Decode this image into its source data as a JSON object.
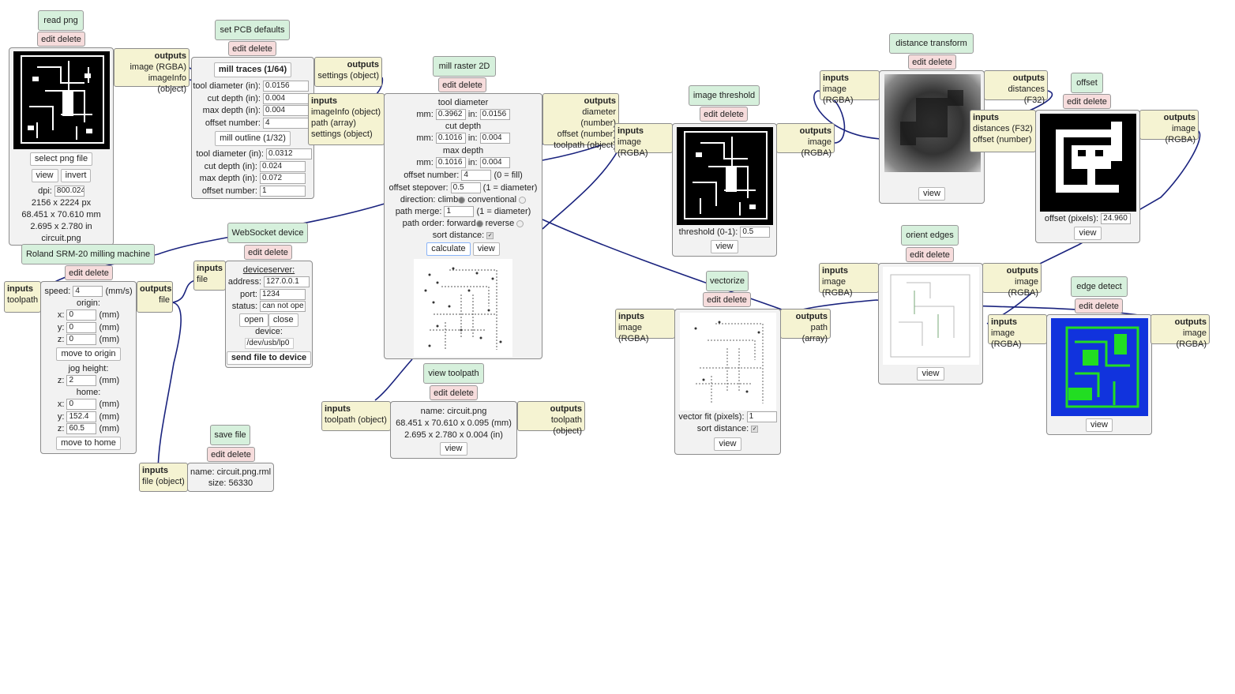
{
  "modules": {
    "read_png": {
      "title": "read png",
      "edit": "edit delete",
      "outputs_header": "outputs",
      "outputs": [
        "image (RGBA)",
        "imageInfo (object)"
      ],
      "select_btn": "select png file",
      "view_btn": "view",
      "invert_btn": "invert",
      "dpi_label": "dpi:",
      "dpi_value": "800.024",
      "px": "2156 x 2224 px",
      "mm": "68.451 x 70.610 mm",
      "in": "2.695 x 2.780 in",
      "file": "circuit.png"
    },
    "pcb_defaults": {
      "title": "set PCB defaults",
      "edit": "edit delete",
      "outputs_header": "outputs",
      "outputs": [
        "settings (object)"
      ],
      "traces_btn": "mill traces (1/64)",
      "traces": [
        {
          "label": "tool diameter (in):",
          "value": "0.0156"
        },
        {
          "label": "cut depth (in):",
          "value": "0.004"
        },
        {
          "label": "max depth (in):",
          "value": "0.004"
        },
        {
          "label": "offset number:",
          "value": "4"
        }
      ],
      "outline_btn": "mill outline (1/32)",
      "outline": [
        {
          "label": "tool diameter (in):",
          "value": "0.0312"
        },
        {
          "label": "cut depth (in):",
          "value": "0.024"
        },
        {
          "label": "max depth (in):",
          "value": "0.072"
        },
        {
          "label": "offset number:",
          "value": "1"
        }
      ]
    },
    "mill_raster": {
      "title": "mill raster 2D",
      "edit": "edit delete",
      "inputs_header": "inputs",
      "inputs": [
        "imageInfo (object)",
        "path (array)",
        "settings (object)"
      ],
      "outputs_header": "outputs",
      "outputs": [
        "diameter (number)",
        "offset (number)",
        "toolpath (object)"
      ],
      "tool_diameter": "tool diameter",
      "mm_label": "mm:",
      "in_label": "in:",
      "td_mm": "0.3962",
      "td_in": "0.0156",
      "cut_depth": "cut depth",
      "cd_mm": "0.1016",
      "cd_in": "0.004",
      "max_depth": "max depth",
      "md_mm": "0.1016",
      "md_in": "0.004",
      "offset_number_label": "offset number:",
      "offset_number": "4",
      "offset_hint": "(0 = fill)",
      "stepover_label": "offset stepover:",
      "stepover": "0.5",
      "stepover_hint": "(1 = diameter)",
      "direction_label": "direction: climb",
      "conventional": "conventional",
      "merge_label": "path merge:",
      "merge": "1",
      "merge_hint": "(1 = diameter)",
      "order_label": "path order: forward",
      "reverse": "reverse",
      "sort_label": "sort distance:",
      "calculate_btn": "calculate",
      "view_btn": "view"
    },
    "roland": {
      "title": "Roland SRM-20 milling machine",
      "edit": "edit delete",
      "inputs_header": "inputs",
      "inputs": [
        "toolpath"
      ],
      "outputs_header": "outputs",
      "outputs": [
        "file"
      ],
      "speed_label": "speed:",
      "speed": "4",
      "speed_unit": "(mm/s)",
      "origin": "origin:",
      "ox": "0",
      "oy": "0",
      "oz": "0",
      "unit": "(mm)",
      "move_origin_btn": "move to origin",
      "jog": "jog height:",
      "jz": "2",
      "home": "home:",
      "hx": "0",
      "hy": "152.4",
      "hz": "60.5",
      "move_home_btn": "move to home",
      "x_label": "x:",
      "y_label": "y:",
      "z_label": "z:"
    },
    "websocket": {
      "title": "WebSocket device",
      "edit": "edit delete",
      "inputs_header": "inputs",
      "inputs": [
        "file"
      ],
      "server": "deviceserver:",
      "address_label": "address:",
      "address": "127.0.0.1",
      "port_label": "port:",
      "port": "1234",
      "status_label": "status:",
      "status": "can not ope",
      "open_btn": "open",
      "close_btn": "close",
      "device_label": "device:",
      "device": "/dev/usb/lp0",
      "send_btn": "send file to device"
    },
    "save_file": {
      "title": "save file",
      "edit": "edit delete",
      "inputs_header": "inputs",
      "inputs": [
        "file (object)"
      ],
      "name": "name: circuit.png.rml",
      "size": "size: 56330"
    },
    "view_toolpath": {
      "title": "view toolpath",
      "edit": "edit delete",
      "inputs_header": "inputs",
      "inputs": [
        "toolpath (object)"
      ],
      "outputs_header": "outputs",
      "outputs": [
        "toolpath (object)"
      ],
      "name": "name: circuit.png",
      "dims_mm": "68.451 x 70.610 x 0.095 (mm)",
      "dims_in": "2.695 x 2.780 x 0.004 (in)",
      "view_btn": "view"
    },
    "image_threshold": {
      "title": "image threshold",
      "edit": "edit delete",
      "inputs_header": "inputs",
      "inputs": [
        "image (RGBA)"
      ],
      "outputs_header": "outputs",
      "outputs": [
        "image (RGBA)"
      ],
      "threshold_label": "threshold (0-1):",
      "threshold": "0.5",
      "view_btn": "view"
    },
    "distance_transform": {
      "title": "distance transform",
      "edit": "edit delete",
      "inputs_header": "inputs",
      "inputs": [
        "image (RGBA)"
      ],
      "outputs_header": "outputs",
      "outputs": [
        "distances (F32)"
      ],
      "view_btn": "view"
    },
    "offset": {
      "title": "offset",
      "edit": "edit delete",
      "inputs_header": "inputs",
      "inputs": [
        "distances (F32)",
        "offset (number)"
      ],
      "outputs_header": "outputs",
      "outputs": [
        "image (RGBA)"
      ],
      "offset_label": "offset (pixels):",
      "offset_value": "24.960",
      "view_btn": "view"
    },
    "orient_edges": {
      "title": "orient edges",
      "edit": "edit delete",
      "inputs_header": "inputs",
      "inputs": [
        "image (RGBA)"
      ],
      "outputs_header": "outputs",
      "outputs": [
        "image (RGBA)"
      ],
      "view_btn": "view"
    },
    "edge_detect": {
      "title": "edge detect",
      "edit": "edit delete",
      "inputs_header": "inputs",
      "inputs": [
        "image (RGBA)"
      ],
      "outputs_header": "outputs",
      "outputs": [
        "image (RGBA)"
      ],
      "view_btn": "view"
    },
    "vectorize": {
      "title": "vectorize",
      "edit": "edit delete",
      "inputs_header": "inputs",
      "inputs": [
        "image (RGBA)"
      ],
      "outputs_header": "outputs",
      "outputs": [
        "path (array)"
      ],
      "fit_label": "vector fit (pixels):",
      "fit": "1",
      "sort_label": "sort distance:",
      "view_btn": "view"
    }
  },
  "colors": {
    "wire": "#1a237e",
    "title_bg": "#d6f0dc",
    "edit_bg": "#f6dcdc",
    "io_bg": "#f5f3d2",
    "edge_blue": "#1133dd",
    "edge_green": "#22dd22"
  }
}
